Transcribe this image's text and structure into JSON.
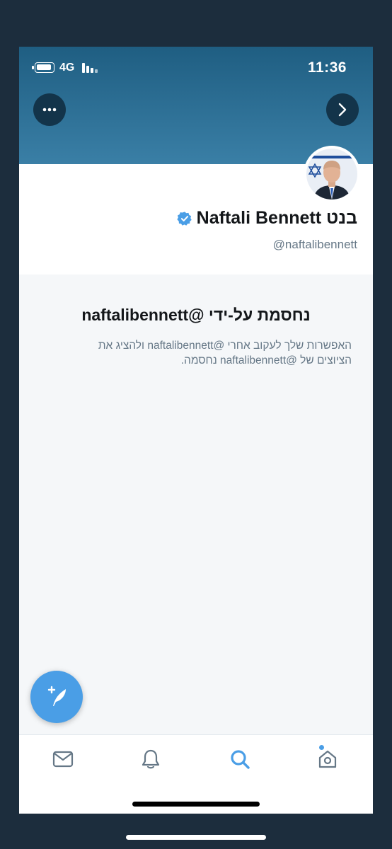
{
  "status_bar": {
    "network": "4G",
    "time": "11:36"
  },
  "profile": {
    "name": "Naftali Bennett בנט",
    "handle": "@naftalibennett",
    "verified": true
  },
  "blocked": {
    "title": "נחסמת על-ידי @naftalibennett",
    "description_line1": "האפשרות שלך לעקוב אחרי @naftalibennett ולהציג את",
    "description_line2": "הציוצים של @naftalibennett נחסמה."
  },
  "icons": {
    "more": "more-icon",
    "next": "chevron-right-icon",
    "verified": "verified-badge-icon",
    "compose": "compose-tweet-icon",
    "messages": "mail-icon",
    "notifications": "bell-icon",
    "search": "search-icon",
    "home": "home-icon"
  },
  "colors": {
    "banner": "#2a6a90",
    "accent": "#4a9ee6",
    "background": "#f5f7f9"
  }
}
